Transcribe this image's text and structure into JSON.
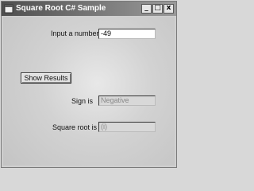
{
  "window": {
    "title": "Square Root C# Sample",
    "minimize_glyph": "_",
    "maximize_glyph": "□",
    "close_glyph": "x"
  },
  "form": {
    "input_label": "Input a number",
    "input_value": "-49",
    "show_results_label": "Show Results",
    "sign_label": "Sign is",
    "sign_value": "Negative",
    "sqrt_label": "Square root is",
    "sqrt_value": "(i)"
  }
}
